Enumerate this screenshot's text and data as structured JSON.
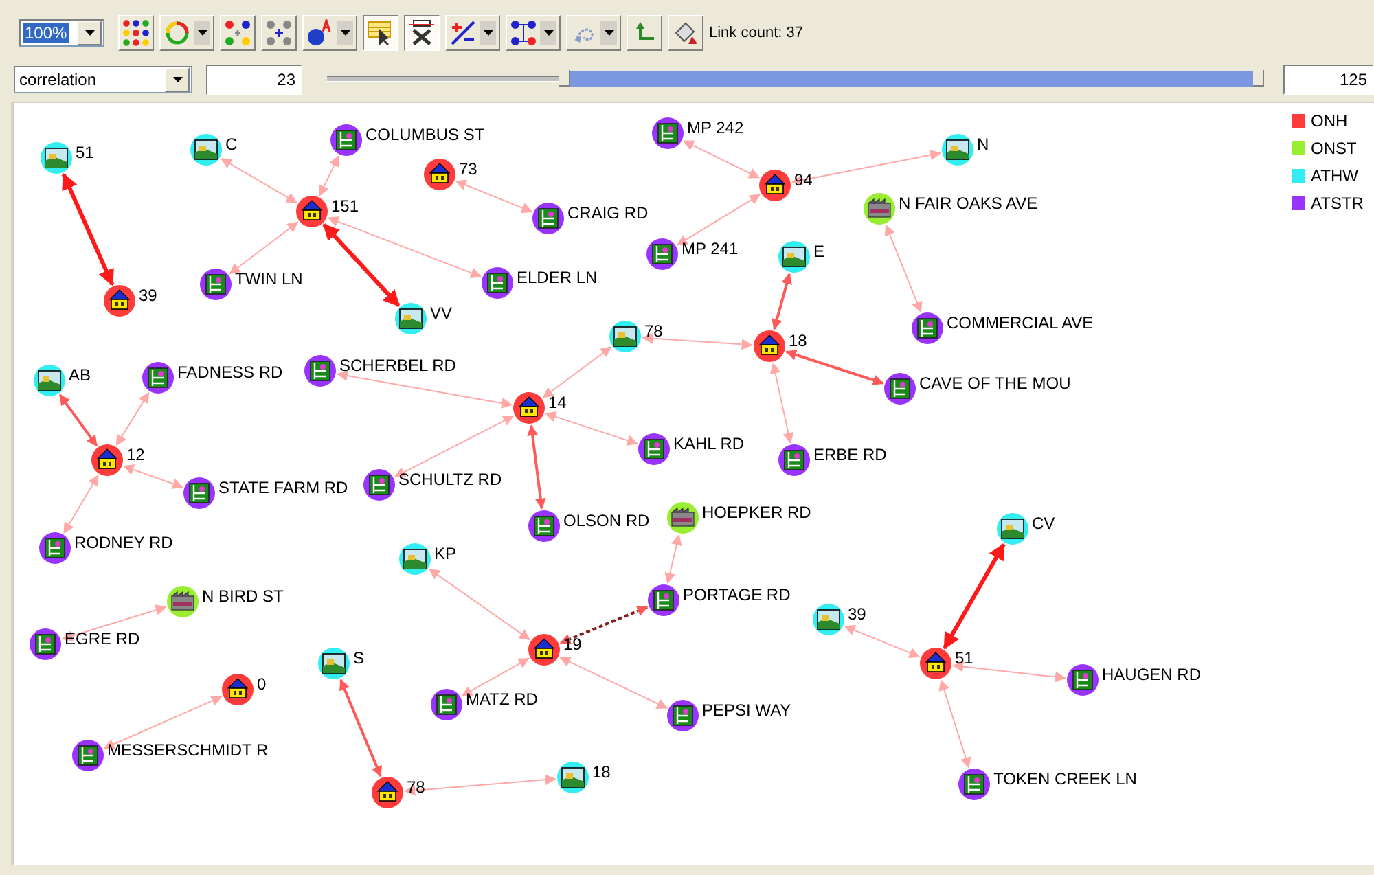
{
  "toolbar": {
    "zoom": {
      "value": "100%"
    },
    "tools": [
      {
        "kind": "dots",
        "pressed": false,
        "dropdown": false
      },
      {
        "kind": "circle",
        "pressed": false,
        "dropdown": true
      },
      {
        "kind": "grid",
        "pressed": false,
        "dropdown": false
      },
      {
        "kind": "compact",
        "pressed": false,
        "dropdown": false
      },
      {
        "kind": "label",
        "pressed": false,
        "dropdown": true
      },
      {
        "kind": "select",
        "pressed": true,
        "dropdown": false
      },
      {
        "kind": "hide",
        "pressed": true,
        "dropdown": false
      },
      {
        "kind": "weight",
        "pressed": false,
        "dropdown": true
      },
      {
        "kind": "connect",
        "pressed": false,
        "dropdown": true
      },
      {
        "kind": "undo",
        "pressed": false,
        "dropdown": true
      },
      {
        "kind": "back",
        "pressed": false,
        "dropdown": false
      },
      {
        "kind": "fill",
        "pressed": false,
        "dropdown": false
      }
    ],
    "link_count": "Link count: 37"
  },
  "filter": {
    "measure": "correlation",
    "min": "23",
    "max": "125",
    "start_thumb": {
      "level": 0.255
    },
    "end_thumb": {
      "level": 1.0
    }
  },
  "legend": [
    {
      "label": "ONH",
      "color": "#ff3b3b"
    },
    {
      "label": "ONST",
      "color": "#99ee33"
    },
    {
      "label": "ATHW",
      "color": "#33eef0"
    },
    {
      "label": "ATSTR",
      "color": "#9933ff"
    }
  ],
  "nodes": [
    {
      "label": "51",
      "kind": "athwy"
    },
    {
      "label": "C",
      "kind": "athwy"
    },
    {
      "label": "COLUMBUS ST",
      "kind": "atstr"
    },
    {
      "label": "73",
      "kind": "onhw"
    },
    {
      "label": "151",
      "kind": "onhw"
    },
    {
      "label": "CRAIG RD",
      "kind": "atstr"
    },
    {
      "label": "TWIN LN",
      "kind": "atstr"
    },
    {
      "label": "ELDER LN",
      "kind": "atstr"
    },
    {
      "label": "39",
      "kind": "onhw"
    },
    {
      "label": "VV",
      "kind": "athwy"
    },
    {
      "label": "MP 242",
      "kind": "atstr"
    },
    {
      "label": "94",
      "kind": "onhw"
    },
    {
      "label": "N",
      "kind": "athwy"
    },
    {
      "label": "N FAIR OAKS AVE",
      "kind": "onstr"
    },
    {
      "label": "MP 241",
      "kind": "atstr"
    },
    {
      "label": "E",
      "kind": "athwy"
    },
    {
      "label": "78",
      "kind": "athwy"
    },
    {
      "label": "18",
      "kind": "onhw"
    },
    {
      "label": "COMMERCIAL AVE",
      "kind": "atstr"
    },
    {
      "label": "AB",
      "kind": "athwy"
    },
    {
      "label": "FADNESS RD",
      "kind": "atstr"
    },
    {
      "label": "SCHERBEL RD",
      "kind": "atstr"
    },
    {
      "label": "14",
      "kind": "onhw"
    },
    {
      "label": "CAVE OF THE MOU",
      "kind": "atstr"
    },
    {
      "label": "12",
      "kind": "onhw"
    },
    {
      "label": "KAHL RD",
      "kind": "atstr"
    },
    {
      "label": "ERBE RD",
      "kind": "atstr"
    },
    {
      "label": "STATE FARM RD",
      "kind": "atstr"
    },
    {
      "label": "SCHULTZ RD",
      "kind": "atstr"
    },
    {
      "label": "OLSON RD",
      "kind": "atstr"
    },
    {
      "label": "HOEPKER RD",
      "kind": "onstr"
    },
    {
      "label": "CV",
      "kind": "athwy"
    },
    {
      "label": "RODNEY RD",
      "kind": "atstr"
    },
    {
      "label": "KP",
      "kind": "athwy"
    },
    {
      "label": "N BIRD ST",
      "kind": "onstr"
    },
    {
      "label": "PORTAGE RD",
      "kind": "atstr"
    },
    {
      "label": "39",
      "kind": "athwy"
    },
    {
      "label": "EGRE RD",
      "kind": "atstr"
    },
    {
      "label": "19",
      "kind": "onhw"
    },
    {
      "label": "51",
      "kind": "onhw"
    },
    {
      "label": "S",
      "kind": "athwy"
    },
    {
      "label": "HAUGEN RD",
      "kind": "atstr"
    },
    {
      "label": "0",
      "kind": "onhw"
    },
    {
      "label": "MATZ RD",
      "kind": "atstr"
    },
    {
      "label": "PEPSI WAY",
      "kind": "atstr"
    },
    {
      "label": "MESSERSCHMIDT R",
      "kind": "atstr"
    },
    {
      "label": "TOKEN CREEK LN",
      "kind": "atstr"
    },
    {
      "label": "78",
      "kind": "onhw"
    },
    {
      "label": "18",
      "kind": "athwy"
    }
  ],
  "links": [
    {
      "kind": "strong",
      "selected": false
    },
    {
      "kind": "weak",
      "selected": false
    },
    {
      "kind": "weak",
      "selected": false
    },
    {
      "kind": "weak",
      "selected": false
    },
    {
      "kind": "weak",
      "selected": false
    },
    {
      "kind": "strong",
      "selected": false
    },
    {
      "kind": "weak",
      "selected": false
    },
    {
      "kind": "weak",
      "selected": false
    },
    {
      "kind": "weak",
      "selected": false
    },
    {
      "kind": "weak",
      "selected": false
    },
    {
      "kind": "weak",
      "selected": false
    },
    {
      "kind": "medium",
      "selected": false
    },
    {
      "kind": "weak",
      "selected": false
    },
    {
      "kind": "medium",
      "selected": false
    },
    {
      "kind": "weak",
      "selected": false
    },
    {
      "kind": "weak",
      "selected": false
    },
    {
      "kind": "weak",
      "selected": false
    },
    {
      "kind": "weak",
      "selected": false
    },
    {
      "kind": "weak",
      "selected": false
    },
    {
      "kind": "medium",
      "selected": false
    },
    {
      "kind": "medium",
      "selected": false
    },
    {
      "kind": "weak",
      "selected": false
    },
    {
      "kind": "weak",
      "selected": false
    },
    {
      "kind": "weak",
      "selected": false
    },
    {
      "kind": "weak",
      "selected": false
    },
    {
      "kind": "weak",
      "selected": false
    },
    {
      "kind": "medium",
      "selected": true
    },
    {
      "kind": "weak",
      "selected": false
    },
    {
      "kind": "weak",
      "selected": false
    },
    {
      "kind": "weak",
      "selected": false
    },
    {
      "kind": "weak",
      "selected": false
    },
    {
      "kind": "medium",
      "selected": false
    },
    {
      "kind": "weak",
      "selected": false
    },
    {
      "kind": "weak",
      "selected": false
    },
    {
      "kind": "strong",
      "selected": false
    },
    {
      "kind": "weak",
      "selected": false
    },
    {
      "kind": "weak",
      "selected": false
    }
  ]
}
